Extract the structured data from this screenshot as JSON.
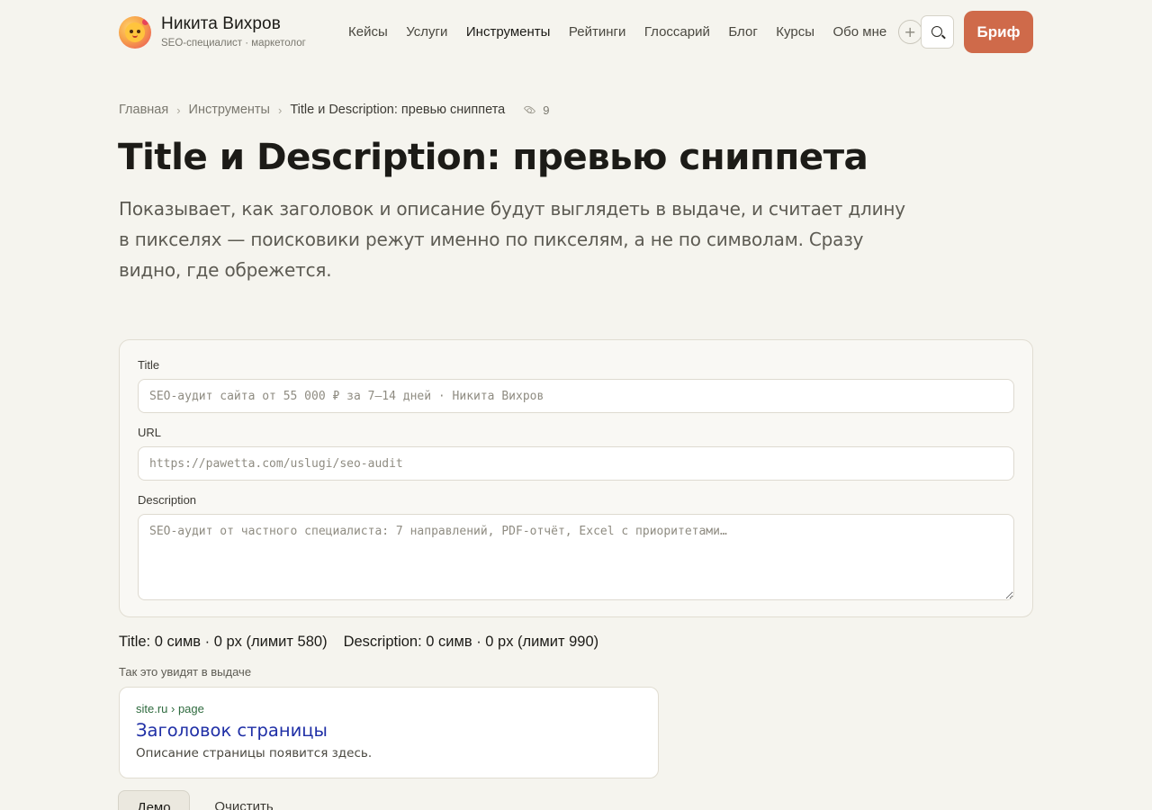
{
  "header": {
    "brand_name": "Никита Вихров",
    "brand_subtitle": "SEO-специалист · маркетолог",
    "nav": [
      {
        "label": "Кейсы"
      },
      {
        "label": "Услуги"
      },
      {
        "label": "Инструменты"
      },
      {
        "label": "Рейтинги"
      },
      {
        "label": "Глоссарий"
      },
      {
        "label": "Блог"
      },
      {
        "label": "Курсы"
      },
      {
        "label": "Обо мне"
      }
    ],
    "active_nav": "Инструменты",
    "more_label": "+",
    "brief_label": "Бриф",
    "accent_color": "#cf6a4a"
  },
  "breadcrumb": {
    "items": [
      "Главная",
      "Инструменты",
      "Title и Description: превью сниппета"
    ],
    "views": "9"
  },
  "page": {
    "title": "Title и Description: превью сниппета",
    "subtitle": "Показывает, как заголовок и описание будут выглядеть в выдаче, и считает длину в пикселях — поисковики режут именно по пикселям, а не по символам. Сразу видно, где обрежется."
  },
  "form": {
    "title_label": "Title",
    "title_value": "",
    "title_placeholder": "SEO-аудит сайта от 55 000 ₽ за 7–14 дней · Никита Вихров",
    "url_label": "URL",
    "url_value": "",
    "url_placeholder": "https://pawetta.com/uslugi/seo-audit",
    "description_label": "Description",
    "description_value": "",
    "description_placeholder": "SEO-аудит от частного специалиста: 7 направлений, PDF-отчёт, Excel с приоритетами…"
  },
  "stats": {
    "title_stat": "Title: 0 симв · 0 px (лимит 580)",
    "description_stat": "Description: 0 симв · 0 px (лимит 990)"
  },
  "serp": {
    "caption": "Так это увидят в выдаче",
    "url": "site.ru › page",
    "title": "Заголовок страницы",
    "description": "Описание страницы появится здесь."
  },
  "actions": {
    "demo_label": "Демо",
    "clear_label": "Очистить"
  }
}
